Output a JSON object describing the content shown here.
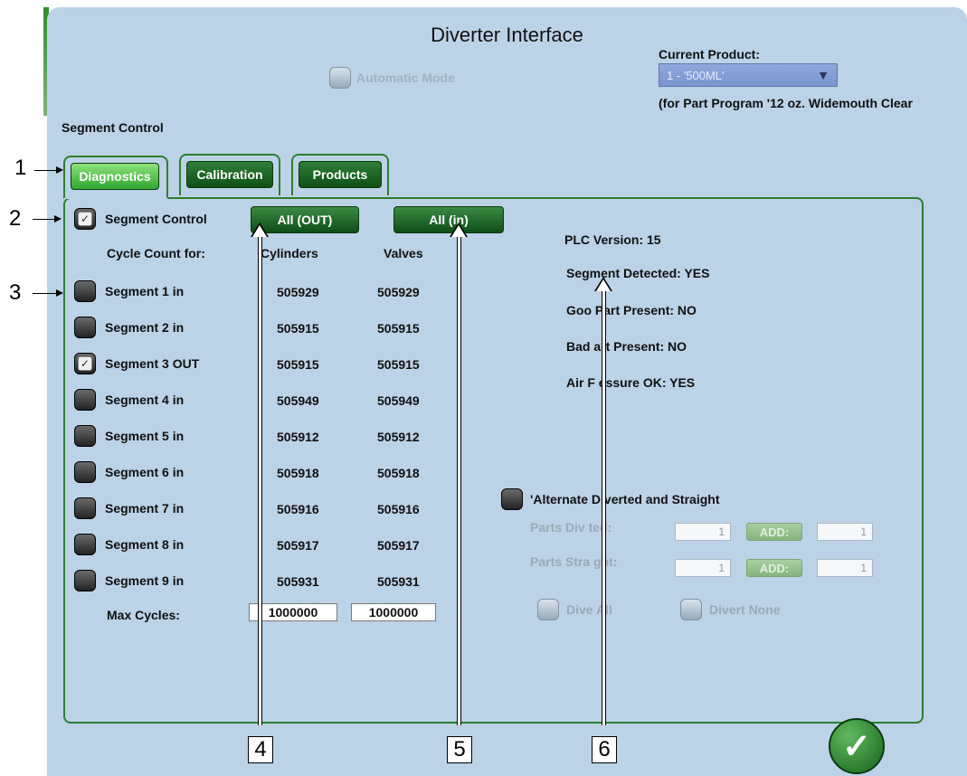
{
  "window": {
    "title": "Diverter Interface"
  },
  "automatic_mode": {
    "label": "Automatic Mode"
  },
  "current_product": {
    "label": "Current Product:",
    "selected": "1 - '500ML'",
    "note": "(for Part Program '12 oz. Widemouth Clear"
  },
  "section_title": "Segment Control",
  "tabs": [
    {
      "label": "Diagnostics",
      "active": true
    },
    {
      "label": "Calibration",
      "active": false
    },
    {
      "label": "Products",
      "active": false
    }
  ],
  "segment_control": {
    "label": "Segment Control",
    "checked": true,
    "all_out_label": "All (OUT)",
    "all_in_label": "All (in)"
  },
  "cycle_count": {
    "label": "Cycle Count for:",
    "col_cylinders": "Cylinders",
    "col_valves": "Valves"
  },
  "segments": [
    {
      "label": "Segment 1 in",
      "checked": false,
      "cylinders": "505929",
      "valves": "505929"
    },
    {
      "label": "Segment 2 in",
      "checked": false,
      "cylinders": "505915",
      "valves": "505915"
    },
    {
      "label": "Segment 3 OUT",
      "checked": true,
      "cylinders": "505915",
      "valves": "505915"
    },
    {
      "label": "Segment 4 in",
      "checked": false,
      "cylinders": "505949",
      "valves": "505949"
    },
    {
      "label": "Segment 5 in",
      "checked": false,
      "cylinders": "505912",
      "valves": "505912"
    },
    {
      "label": "Segment 6 in",
      "checked": false,
      "cylinders": "505918",
      "valves": "505918"
    },
    {
      "label": "Segment 7 in",
      "checked": false,
      "cylinders": "505916",
      "valves": "505916"
    },
    {
      "label": "Segment 8 in",
      "checked": false,
      "cylinders": "505917",
      "valves": "505917"
    },
    {
      "label": "Segment 9 in",
      "checked": false,
      "cylinders": "505931",
      "valves": "505931"
    }
  ],
  "max_cycles": {
    "label": "Max Cycles:",
    "cylinders": "1000000",
    "valves": "1000000"
  },
  "status": {
    "plc_version": "PLC Version: 15",
    "segment_detected": "Segment Detected: YES",
    "good_part": "Goo  Part Present: NO",
    "bad_part": "Bad  art Present: NO",
    "air_pressure": "Air F  essure OK: YES"
  },
  "alternate": {
    "label": "'Alternate  Diverted and Straight",
    "parts_diverted_label": "Parts Div  ted:",
    "parts_diverted_value": "1",
    "parts_diverted_add": "ADD:",
    "parts_diverted_add_value": "1",
    "parts_straight_label": "Parts Stra  ght:",
    "parts_straight_value": "1",
    "parts_straight_add": "ADD:",
    "parts_straight_add_value": "1",
    "divert_all": "Dive   All",
    "divert_none": "Divert None"
  },
  "ok_button": {
    "icon": "checkmark-icon"
  },
  "annotations": [
    "1",
    "2",
    "3",
    "4",
    "5",
    "6"
  ]
}
